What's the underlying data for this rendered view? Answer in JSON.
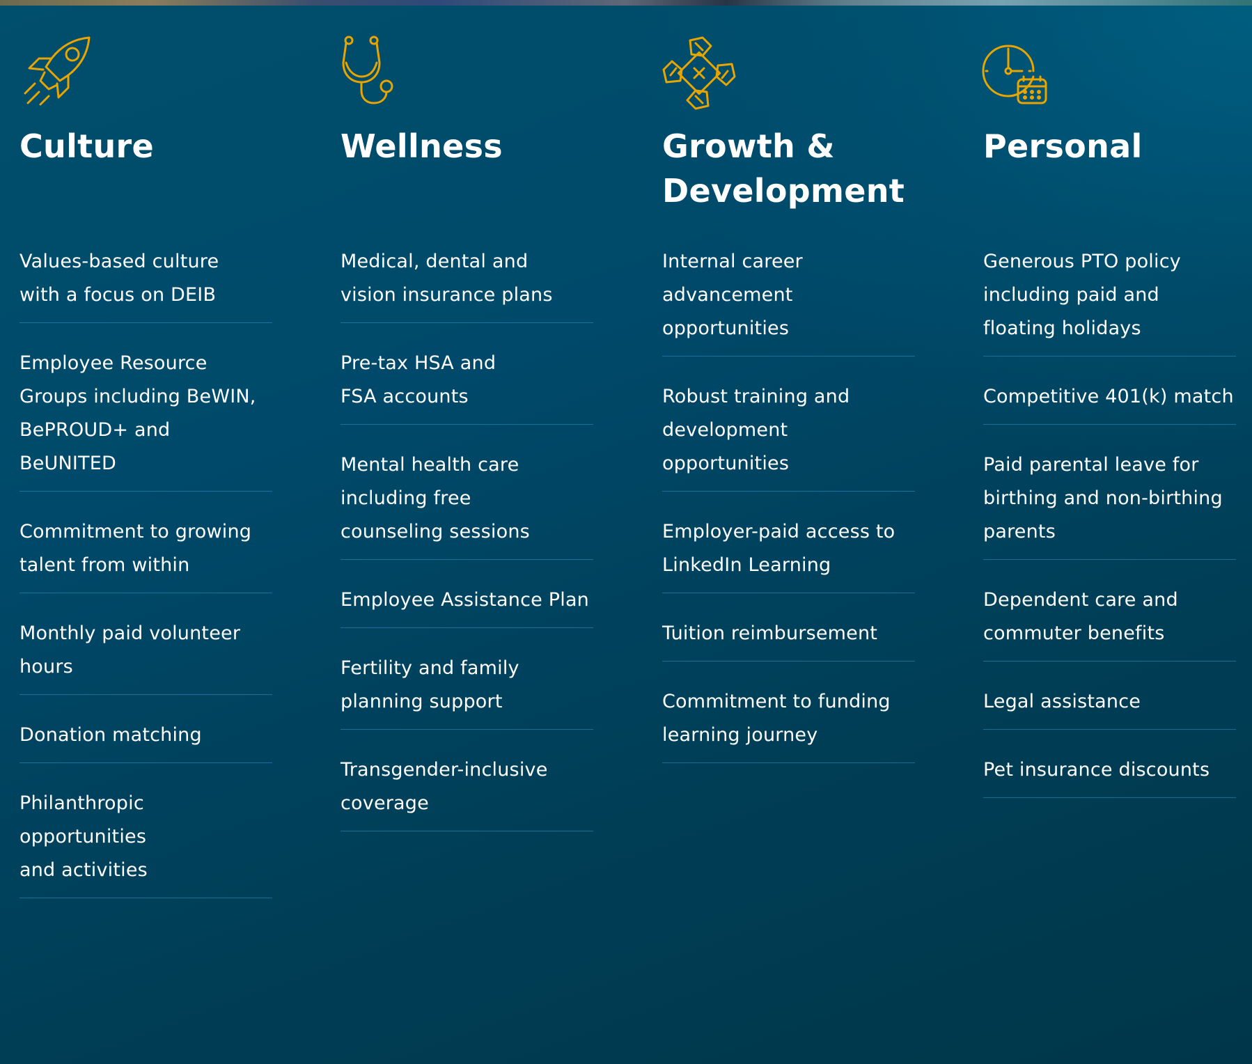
{
  "columns": [
    {
      "id": "culture",
      "icon": "rocket-icon",
      "title": "Culture",
      "items": [
        "Values-based culture\nwith a focus on DEIB",
        "Employee Resource\nGroups including BeWIN,\nBePROUD+ and BeUNITED",
        "Commitment to growing\ntalent from within",
        "Monthly paid volunteer\nhours",
        "Donation matching",
        "Philanthropic opportunities\nand activities"
      ]
    },
    {
      "id": "wellness",
      "icon": "stethoscope-icon",
      "title": "Wellness",
      "items": [
        "Medical, dental and\nvision insurance plans",
        "Pre-tax HSA and\nFSA accounts",
        "Mental health care\nincluding free\ncounseling sessions",
        "Employee Assistance Plan",
        "Fertility and family\nplanning support",
        "Transgender-inclusive\ncoverage"
      ]
    },
    {
      "id": "growth",
      "icon": "joined-hands-icon",
      "title": "Growth &\nDevelopment",
      "items": [
        "Internal career\nadvancement opportunities",
        "Robust training and\ndevelopment opportunities",
        "Employer-paid access to\nLinkedIn Learning",
        "Tuition reimbursement",
        "Commitment to funding\nlearning journey"
      ]
    },
    {
      "id": "personal",
      "icon": "clock-calendar-icon",
      "title": "Personal",
      "items": [
        "Generous PTO policy\nincluding paid and\nfloating holidays",
        "Competitive 401(k) match",
        "Paid parental leave for\nbirthing and non-birthing\nparents",
        "Dependent care and\ncommuter benefits",
        "Legal assistance",
        "Pet insurance discounts"
      ]
    }
  ],
  "colors": {
    "accent": "#e8a500",
    "text": "#ffffff",
    "divider": "#2896c8",
    "background": "#004a66"
  }
}
